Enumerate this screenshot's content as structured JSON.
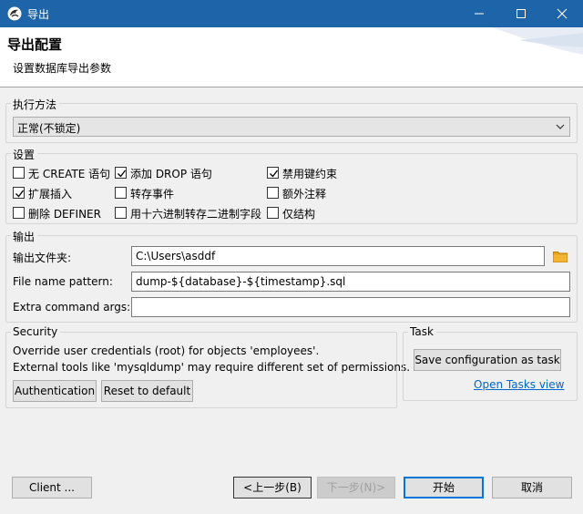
{
  "window": {
    "title": "导出"
  },
  "header": {
    "title": "导出配置",
    "subtitle": "设置数据库导出参数"
  },
  "method": {
    "label": "执行方法",
    "selected": "正常(不锁定)"
  },
  "settings": {
    "label": "设置",
    "options": [
      {
        "label": "无 CREATE 语句",
        "checked": false
      },
      {
        "label": "添加 DROP 语句",
        "checked": true
      },
      {
        "label": "禁用键约束",
        "checked": true
      },
      {
        "label": "扩展插入",
        "checked": true
      },
      {
        "label": "转存事件",
        "checked": false
      },
      {
        "label": "额外注释",
        "checked": false
      },
      {
        "label": "删除 DEFINER",
        "checked": false
      },
      {
        "label": "用十六进制转存二进制字段",
        "checked": false
      },
      {
        "label": "仅结构",
        "checked": false
      }
    ]
  },
  "output": {
    "label": "输出",
    "folder_label": "输出文件夹:",
    "folder_value": "C:\\Users\\asddf",
    "pattern_label": "File name pattern:",
    "pattern_value": "dump-${database}-${timestamp}.sql",
    "extra_label": "Extra command args:",
    "extra_value": ""
  },
  "security": {
    "label": "Security",
    "line1": "Override user credentials (root) for objects 'employees'.",
    "line2": "External tools like 'mysqldump' may require different set of permissions.",
    "auth_button": "Authentication",
    "reset_button": "Reset to default"
  },
  "task": {
    "label": "Task",
    "save_button": "Save configuration as task",
    "open_link": "Open Tasks view"
  },
  "footer": {
    "client_button": "Client ...",
    "back_button": "<上一步(B)",
    "next_button": "下一步(N)>",
    "start_button": "开始",
    "cancel_button": "取消"
  },
  "colors": {
    "titlebar": "#1e64a8",
    "accent": "#0078d7",
    "folder": "#e8a21b",
    "link": "#0066cc"
  }
}
